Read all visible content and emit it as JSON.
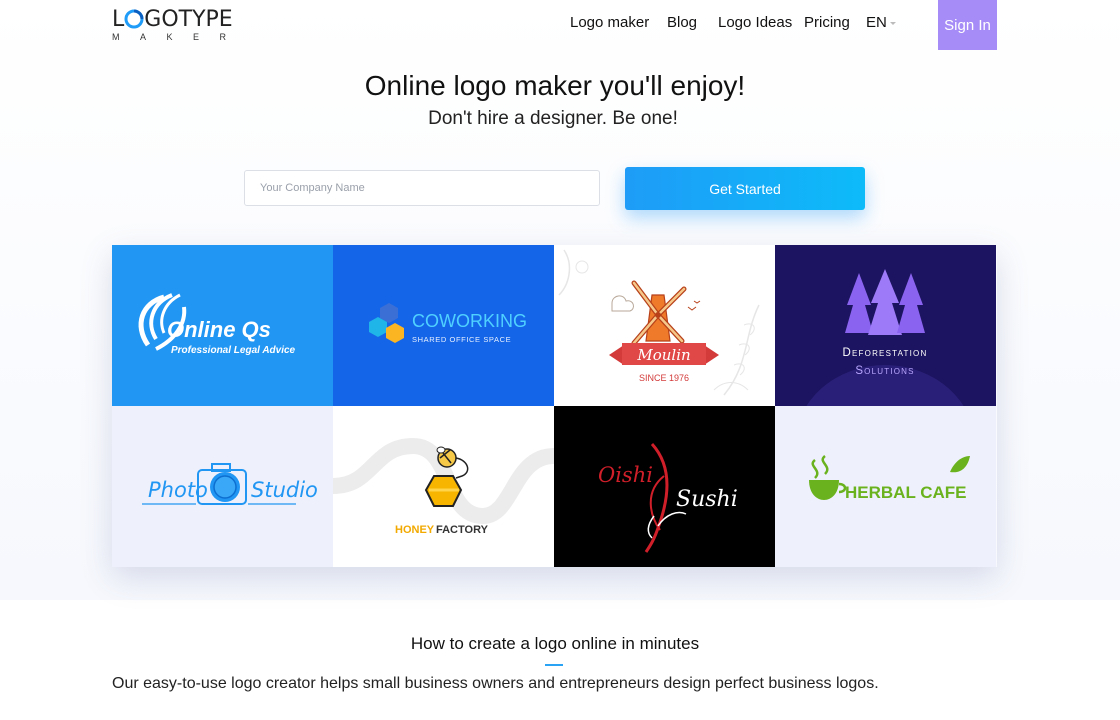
{
  "brand": {
    "logo_main": "LOGOTYPE",
    "logo_sub": "MAKER"
  },
  "nav": {
    "items": [
      "Logo maker",
      "Blog",
      "Logo Ideas",
      "Pricing"
    ],
    "language": "EN",
    "signin": "Sign In"
  },
  "hero": {
    "title": "Online logo maker you'll enjoy!",
    "subtitle": "Don't hire a designer. Be one!",
    "input_placeholder": "Your Company Name",
    "cta": "Get Started"
  },
  "logos": [
    {
      "name": "Online Qs",
      "tagline": "Professional Legal Advice",
      "bg": "#2196f3"
    },
    {
      "name": "COWORKING",
      "tagline": "SHARED OFFICE SPACE",
      "bg": "#1565e8"
    },
    {
      "name": "Moulin",
      "tagline": "SINCE 1976",
      "bg": "#ffffff"
    },
    {
      "name": "Deforestation",
      "tagline": "Solutions",
      "bg": "#1c1460"
    },
    {
      "name_left": "Photo",
      "name_right": "Studio",
      "bg": "#eef1fb"
    },
    {
      "name_left": "HONEY",
      "name_right": "FACTORY",
      "bg": "#ffffff"
    },
    {
      "name_left": "Oishi",
      "name_right": "Sushi",
      "bg": "#000000"
    },
    {
      "name": "HERBAL CAFE",
      "bg": "#eef1fb"
    }
  ],
  "section": {
    "title": "How to create a logo online in minutes",
    "text": "Our easy-to-use logo creator helps small business owners and entrepreneurs design perfect business logos."
  },
  "colors": {
    "accent": "#1e9cf7",
    "signin_bg": "#a68cf6",
    "underline": "#2aa3f5"
  }
}
